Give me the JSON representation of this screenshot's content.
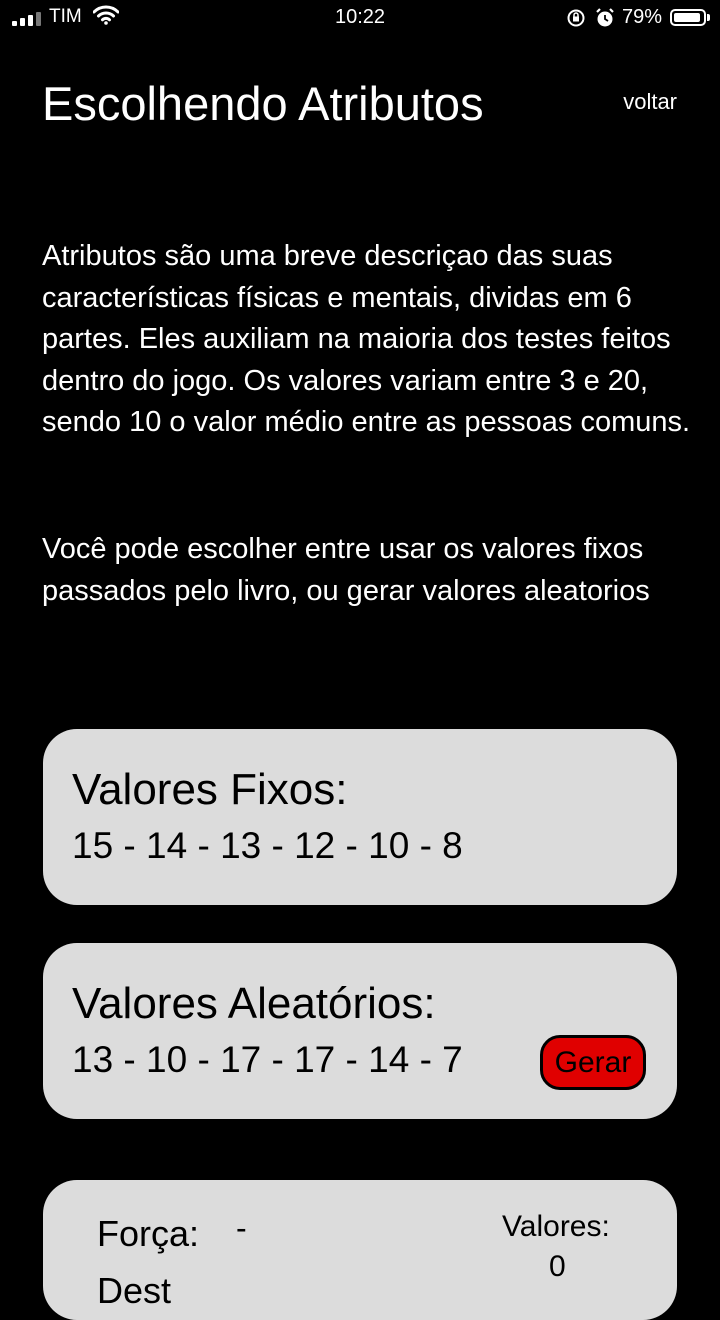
{
  "status_bar": {
    "carrier": "TIM",
    "time": "10:22",
    "battery": "79%",
    "battery_level": 0.79,
    "icons": [
      "signal-icon",
      "wifi-icon",
      "rotation-lock-icon",
      "alarm-icon",
      "battery-icon"
    ]
  },
  "header": {
    "title": "Escolhendo Atributos",
    "back_label": "voltar"
  },
  "intro": {
    "paragraph1": "Atributos são uma breve descriçao das suas características físicas e mentais, dividas em 6 partes. Eles auxiliam na maioria dos testes feitos dentro do jogo. Os valores variam entre 3 e 20, sendo 10 o valor médio entre as pessoas comuns.",
    "paragraph2": "Você pode escolher entre usar os valores fixos passados pelo livro, ou gerar valores aleatorios"
  },
  "fixed_values": {
    "title": "Valores Fixos:",
    "values": "15 - 14 - 13 - 12 - 10 - 8"
  },
  "random_values": {
    "title": "Valores Aleatórios:",
    "values": "13 - 10 - 17 - 17 - 14 - 7",
    "button_label": "Gerar"
  },
  "attributes": {
    "row1_label": "Força:",
    "row1_value": "-",
    "row2_label": "Dest",
    "valores_label": "Valores:",
    "valores_count": "0"
  },
  "colors": {
    "background": "#000000",
    "card": "#dcdcdc",
    "button": "#e00000"
  }
}
